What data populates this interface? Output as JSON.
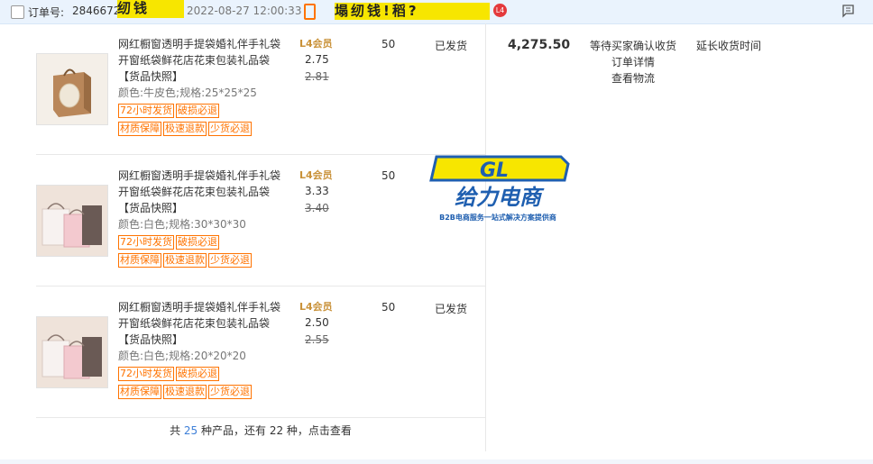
{
  "header": {
    "order_label": "订单号:",
    "order_no": "2846672",
    "seller_name": "纫钱",
    "datetime": "2022-08-27 12:00:33",
    "shop_name": "塌纫钱!稻?",
    "shop_badge": "L4"
  },
  "products": [
    {
      "title": "网红橱窗透明手提袋婚礼伴手礼袋开窗纸袋鲜花店花束包装礼品袋 【货品快照】",
      "spec": "颜色:牛皮色;规格:25*25*25",
      "tags": [
        "72小时发货",
        "破损必退",
        "材质保障",
        "极速退款",
        "少货必退"
      ],
      "level": "L4会员",
      "price": "2.75",
      "original_price": "2.81",
      "quantity": "50",
      "status": "已发货"
    },
    {
      "title": "网红橱窗透明手提袋婚礼伴手礼袋开窗纸袋鲜花店花束包装礼品袋 【货品快照】",
      "spec": "颜色:白色;规格:30*30*30",
      "tags": [
        "72小时发货",
        "破损必退",
        "材质保障",
        "极速退款",
        "少货必退"
      ],
      "level": "L4会员",
      "price": "3.33",
      "original_price": "3.40",
      "quantity": "50",
      "status": ""
    },
    {
      "title": "网红橱窗透明手提袋婚礼伴手礼袋开窗纸袋鲜花店花束包装礼品袋 【货品快照】",
      "spec": "颜色:白色;规格:20*20*20",
      "tags": [
        "72小时发货",
        "破损必退",
        "材质保障",
        "极速退款",
        "少货必退"
      ],
      "level": "L4会员",
      "price": "2.50",
      "original_price": "2.55",
      "quantity": "50",
      "status": "已发货"
    }
  ],
  "summary": {
    "prefix": "共",
    "count": "25",
    "suffix": "种产品，还有 22 种，点击查看"
  },
  "order": {
    "total": "4,275.50",
    "status": "等待买家确认收货",
    "link_detail": "订单详情",
    "link_logistics": "查看物流",
    "extend_receive": "延长收货时间"
  },
  "watermark": {
    "logo_text": "GL",
    "name": "给力电商",
    "slogan": "B2B电商服务一站式解决方案提供商"
  },
  "colors": {
    "header_bg": "#eaf3fd",
    "tag": "#ff7300",
    "mask_yellow": "#f7e600",
    "link_blue": "#3d7fd8",
    "watermark_blue": "#1f5fb0"
  },
  "icons": {
    "checkbox": "checkbox-icon",
    "phone": "phone-icon",
    "shop_badge": "shop-level-badge",
    "flag": "flag-icon"
  }
}
